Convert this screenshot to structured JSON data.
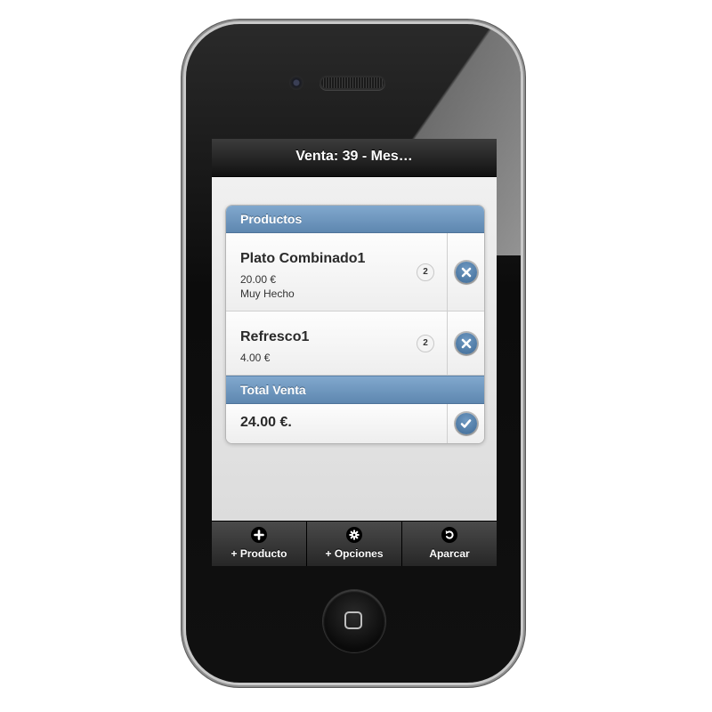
{
  "header": {
    "title": "Venta: 39 - Mes…"
  },
  "products": {
    "heading": "Productos",
    "items": [
      {
        "name": "Plato Combinado1",
        "price": "20.00 €",
        "note": "Muy Hecho",
        "count": "2",
        "action_icon": "delete-icon"
      },
      {
        "name": "Refresco1",
        "price": "4.00 €",
        "count": "2",
        "action_icon": "delete-icon"
      }
    ]
  },
  "total": {
    "heading": "Total Venta",
    "value": "24.00 €.",
    "action_icon": "check-icon"
  },
  "footer": {
    "buttons": [
      {
        "label": "+ Producto",
        "icon": "plus-icon"
      },
      {
        "label": "+ Opciones",
        "icon": "gear-icon"
      },
      {
        "label": "Aparcar",
        "icon": "back-icon"
      }
    ]
  },
  "colors": {
    "accent": "#5e87b0",
    "header_bg": "#111111",
    "content_bg": "#e4e4e4"
  }
}
